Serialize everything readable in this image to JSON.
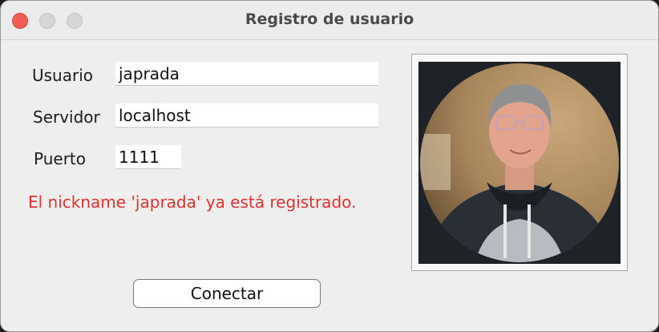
{
  "window": {
    "title": "Registro de usuario"
  },
  "form": {
    "user_label": "Usuario",
    "user_value": "japrada",
    "server_label": "Servidor",
    "server_value": "localhost",
    "port_label": "Puerto",
    "port_value": "1111"
  },
  "status": {
    "error": "El nickname 'japrada' ya está registrado."
  },
  "actions": {
    "connect_label": "Conectar"
  },
  "photo": {
    "icon": "user-avatar-photo"
  },
  "colors": {
    "error": "#e3312c",
    "close_light": "#ee5f58"
  }
}
